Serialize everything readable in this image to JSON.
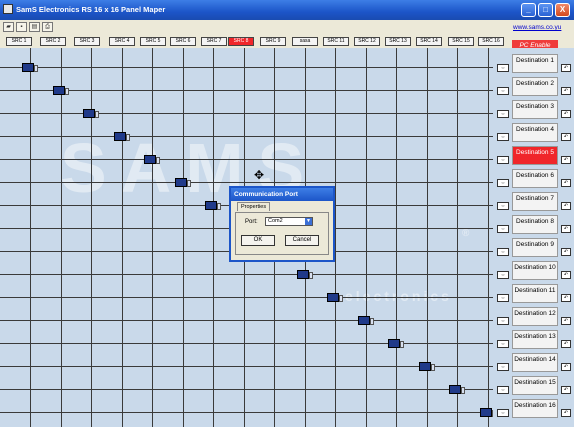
{
  "window": {
    "title": "SamS Electronics RS 16 x 16 Panel Maper",
    "minimize": "_",
    "maximize": "□",
    "close": "X"
  },
  "toolbar": {
    "buttons": [
      {
        "name": "open-icon",
        "glyph": "▰"
      },
      {
        "name": "save-icon",
        "glyph": "▪"
      },
      {
        "name": "properties-icon",
        "glyph": "▤"
      },
      {
        "name": "print-icon",
        "glyph": "⎙"
      }
    ]
  },
  "website": "www.sams.co.yu",
  "pc_enable": "PC Enable",
  "sources": [
    "SRC 1",
    "SRC 2",
    "SRC 3",
    "SRC 4",
    "SRC 5",
    "SRC 6",
    "SRC 7",
    "SRC 8",
    "SRC 9",
    "sasa",
    "SRC 11",
    "SRC 12",
    "SRC 13",
    "SRC 14",
    "SRC 15",
    "SRC 16"
  ],
  "active_source_index": 7,
  "destinations": [
    "Destination 1",
    "Destination 2",
    "Destination 3",
    "Destination 4",
    "Destination 5",
    "Destination 6",
    "Destination 7",
    "Destination 8",
    "Destination 9",
    "Destination 10",
    "Destination 11",
    "Destination 12",
    "Destination 13",
    "Destination 14",
    "Destination 15",
    "Destination 16"
  ],
  "active_destination_index": 4,
  "destination_icon_left": "⇔",
  "destination_icon_right": "↶",
  "watermark": {
    "brand": "SAMS",
    "sub": "electronics",
    "mark": "®"
  },
  "dialog": {
    "title": "Communication Port",
    "tab": "Properties",
    "port_label": "Port:",
    "port_value": "Com2",
    "ok": "OK",
    "cancel": "Cancel"
  },
  "colors": {
    "active": "#f0262a",
    "accent": "#1c55c8",
    "grid_bg": "#c9d9ea"
  }
}
